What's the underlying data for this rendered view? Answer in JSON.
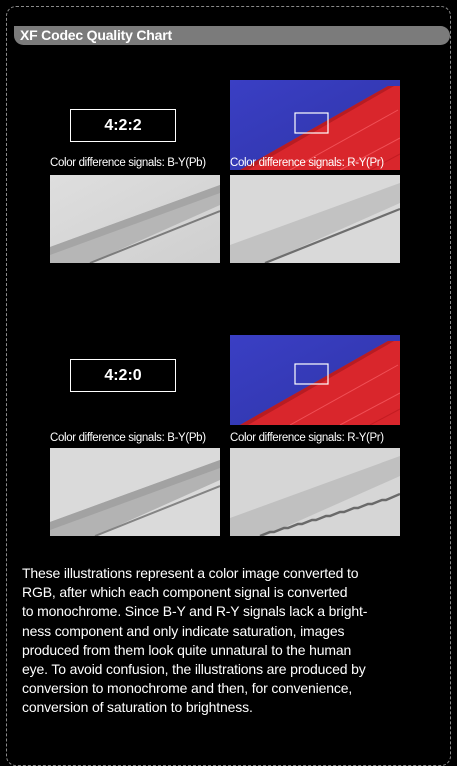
{
  "title": "XF Codec Quality Chart",
  "sections": [
    {
      "label": "4:2:2",
      "caption_left": "Color difference signals: B-Y(Pb)",
      "caption_right": "Color difference signals: R-Y(Pr)"
    },
    {
      "label": "4:2:0",
      "caption_left": "Color difference signals: B-Y(Pb)",
      "caption_right": "Color difference signals: R-Y(Pr)"
    }
  ],
  "description": [
    "These illustrations represent a color image converted to",
    "RGB, after which each component signal is converted",
    "to monochrome. Since B-Y and R-Y signals lack a bright-",
    "ness component and only indicate saturation, images",
    "produced from them look quite unnatural to the human",
    "eye. To avoid confusion, the illustrations are produced by",
    "conversion to monochrome and then, for convenience,",
    "conversion of saturation to brightness."
  ],
  "colors": {
    "background": "#000000",
    "title_bar": "#7b7b7b",
    "photo_blue": "#3b3ec2",
    "photo_red": "#e0242b"
  }
}
